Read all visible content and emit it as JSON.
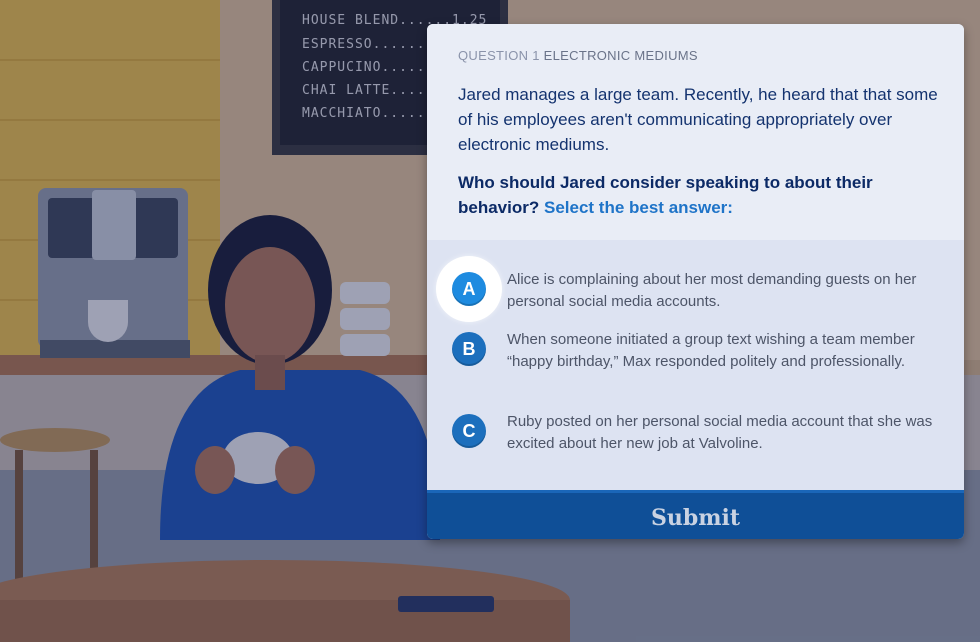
{
  "menu_board": {
    "items": [
      "HOUSE BLEND......1.25",
      "ESPRESSO.........",
      "CAPPUCINO.......",
      "CHAI LATTE.......",
      "MACCHIATO........"
    ]
  },
  "question": {
    "number_label": "QUESTION 1",
    "category": "ELECTRONIC MEDIUMS",
    "text": "Jared manages a large team. Recently, he heard that that some of his employees aren't communicating appropriately over electronic mediums.",
    "prompt": "Who should Jared consider speaking to about their behavior?",
    "instruction": "Select the best answer:"
  },
  "options": [
    {
      "letter": "A",
      "text": "Alice is complaining about her most demanding guests on her personal social media accounts.",
      "selected": true
    },
    {
      "letter": "B",
      "text": "When someone initiated a group text wishing a team member “happy birthday,” Max responded politely and professionally.",
      "selected": false
    },
    {
      "letter": "C",
      "text": "Ruby posted on her personal social media account that she was excited about her new job at Valvoline.",
      "selected": false
    }
  ],
  "submit_label": "Submit",
  "colors": {
    "accent": "#1c6fbd",
    "submit": "#0f4f97",
    "heading": "#0c2a66"
  }
}
